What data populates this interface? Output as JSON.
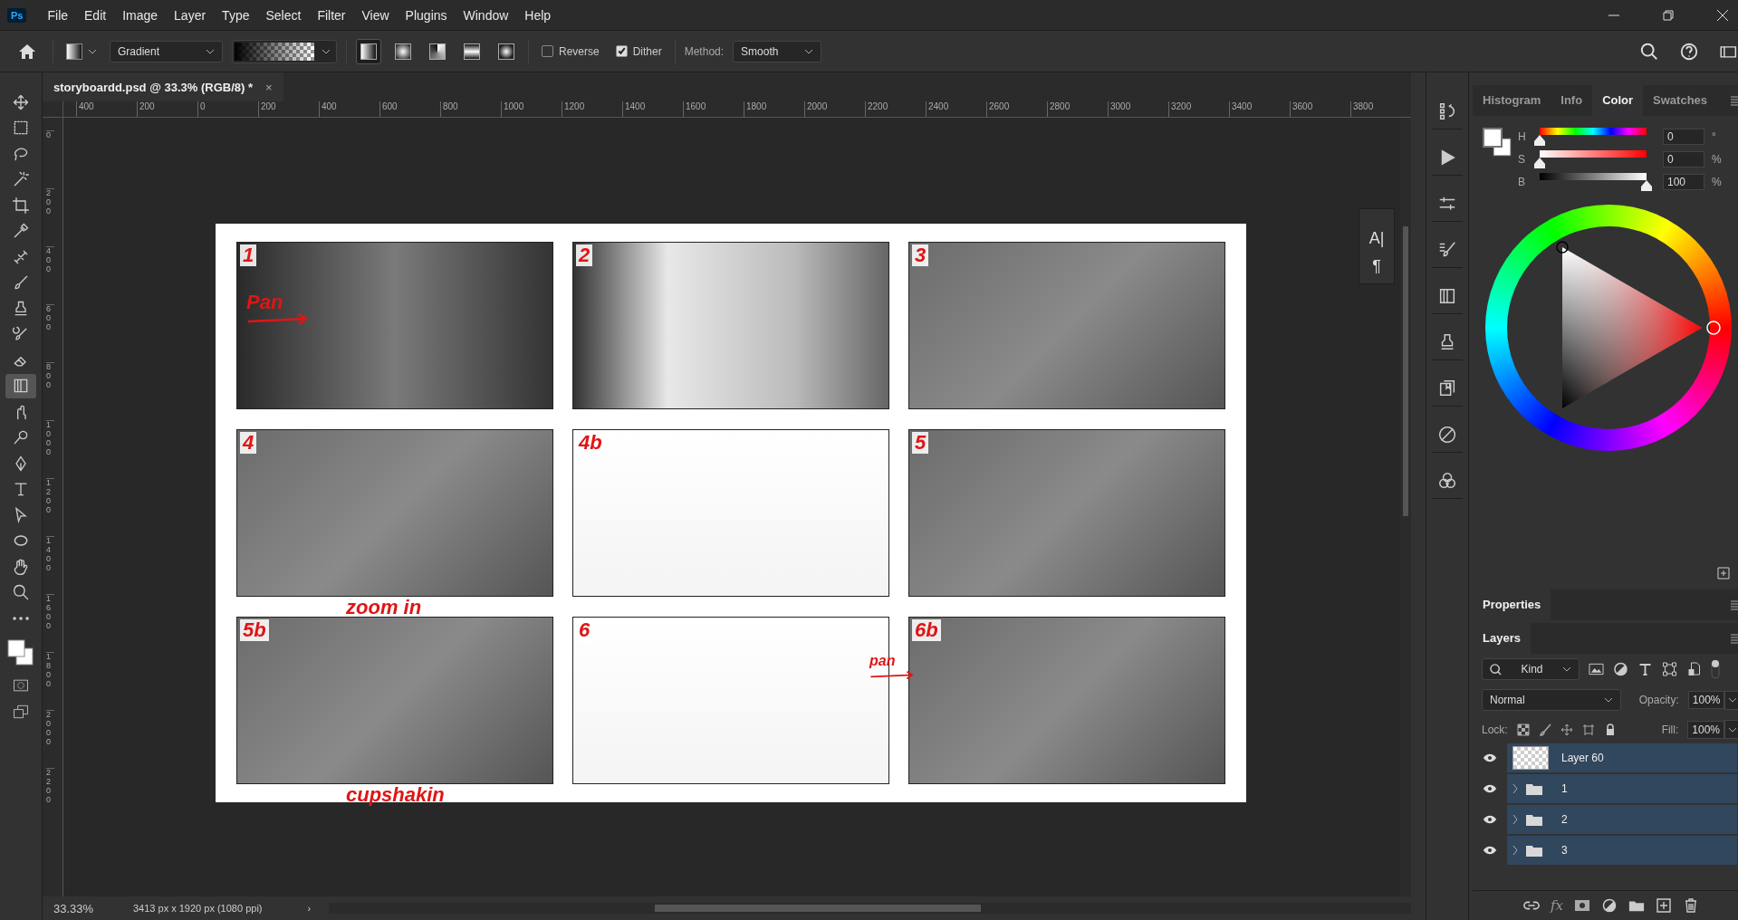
{
  "menu_bar": {
    "logo": "Ps",
    "items": [
      "File",
      "Edit",
      "Image",
      "Layer",
      "Type",
      "Select",
      "Filter",
      "View",
      "Plugins",
      "Window",
      "Help"
    ]
  },
  "options_bar": {
    "preset": "Gradient",
    "gradient_types": [
      {
        "kind": "linear",
        "selected": true
      },
      {
        "kind": "radial",
        "selected": false
      },
      {
        "kind": "angle",
        "selected": false
      },
      {
        "kind": "reflected",
        "selected": false
      },
      {
        "kind": "diamond",
        "selected": false
      }
    ],
    "checkboxes": [
      {
        "label": "Reverse",
        "checked": false
      },
      {
        "label": "Dither",
        "checked": true
      }
    ],
    "method_label": "Method:",
    "method": "Smooth"
  },
  "document_tab": {
    "title": "storyboardd.psd @ 33.3% (RGB/8) *",
    "close": "×"
  },
  "ruler_h": [
    "400",
    "200",
    "0",
    "200",
    "400",
    "600",
    "800",
    "1000",
    "1200",
    "1400",
    "1600",
    "1800",
    "2000",
    "2200",
    "2400",
    "2600",
    "2800",
    "3000",
    "3200",
    "3400",
    "3600",
    "3800"
  ],
  "ruler_v": [
    "0",
    "200",
    "400",
    "600",
    "800",
    "1000",
    "1200",
    "1400",
    "1600",
    "1800",
    "2000",
    "2200"
  ],
  "tools": [
    {
      "kind": "move",
      "selected": false
    },
    {
      "kind": "marquee",
      "selected": false
    },
    {
      "kind": "lasso",
      "selected": false
    },
    {
      "kind": "wand",
      "selected": false
    },
    {
      "kind": "crop",
      "selected": false
    },
    {
      "kind": "eyedropper",
      "selected": false
    },
    {
      "kind": "heal",
      "selected": false
    },
    {
      "kind": "brush",
      "selected": false
    },
    {
      "kind": "stamp",
      "selected": false
    },
    {
      "kind": "historybrush",
      "selected": false
    },
    {
      "kind": "eraser",
      "selected": false
    },
    {
      "kind": "gradient",
      "selected": true
    },
    {
      "kind": "smudge",
      "selected": false
    },
    {
      "kind": "dodge",
      "selected": false
    },
    {
      "kind": "pen",
      "selected": false
    },
    {
      "kind": "type",
      "selected": false
    },
    {
      "kind": "select",
      "selected": false
    },
    {
      "kind": "ellipse",
      "selected": false
    },
    {
      "kind": "hand",
      "selected": false
    },
    {
      "kind": "zoom",
      "selected": false
    },
    {
      "kind": "more",
      "selected": false
    }
  ],
  "storyboard": {
    "panels": [
      {
        "label": "1",
        "notes": [
          {
            "text": "Pan",
            "arrow": true
          }
        ]
      },
      {
        "label": "2"
      },
      {
        "label": "3"
      },
      {
        "label": "4",
        "notes": [
          {
            "text": "zoom in",
            "arrow": false
          }
        ]
      },
      {
        "label": "4b"
      },
      {
        "label": "5"
      },
      {
        "label": "5b",
        "notes": [
          {
            "text": "cupshakin",
            "arrow": false
          }
        ]
      },
      {
        "label": "6"
      },
      {
        "label": "6b",
        "notes": [
          {
            "text": "pan",
            "arrow": true
          }
        ]
      }
    ]
  },
  "floating_panel": {
    "items": [
      "A|",
      "¶"
    ]
  },
  "side_icons": [
    {
      "kind": "history"
    },
    {
      "kind": "play"
    },
    {
      "kind": "adjust"
    },
    {
      "kind": "brushset"
    },
    {
      "kind": "gradient"
    },
    {
      "kind": "stamp"
    },
    {
      "kind": "library"
    },
    {
      "kind": "halfcircle"
    },
    {
      "kind": "channels"
    }
  ],
  "color_panel": {
    "tabs": [
      {
        "label": "Histogram",
        "selected": false
      },
      {
        "label": "Info",
        "selected": false
      },
      {
        "label": "Color",
        "selected": true
      },
      {
        "label": "Swatches",
        "selected": false
      }
    ],
    "sliders": [
      {
        "label": "H",
        "kind": "hue",
        "level": 0,
        "value": "0",
        "unit": "°"
      },
      {
        "label": "S",
        "kind": "saturation",
        "level": 0,
        "value": "0",
        "unit": "%"
      },
      {
        "label": "B",
        "kind": "brightness",
        "level": 1,
        "value": "100",
        "unit": "%"
      }
    ]
  },
  "properties_panel": {
    "title": "Properties"
  },
  "layers_panel": {
    "tab": "Layers",
    "filter": "Kind",
    "blend_mode": "Normal",
    "opacity_label": "Opacity:",
    "opacity": "100%",
    "lock_label": "Lock:",
    "fill_label": "Fill:",
    "fill": "100%",
    "fx": "fx",
    "layers": [
      {
        "name": "Layer 60",
        "kind": "pixel",
        "visible": true,
        "selected": true
      },
      {
        "name": "1",
        "kind": "group",
        "visible": true,
        "selected": true
      },
      {
        "name": "2",
        "kind": "group",
        "visible": true,
        "selected": true
      },
      {
        "name": "3",
        "kind": "group",
        "visible": true,
        "selected": true
      }
    ]
  },
  "status_bar": {
    "zoom": "33.33%",
    "doc_info": "3413 px x 1920 px (1080 ppi)",
    "more": "›"
  }
}
